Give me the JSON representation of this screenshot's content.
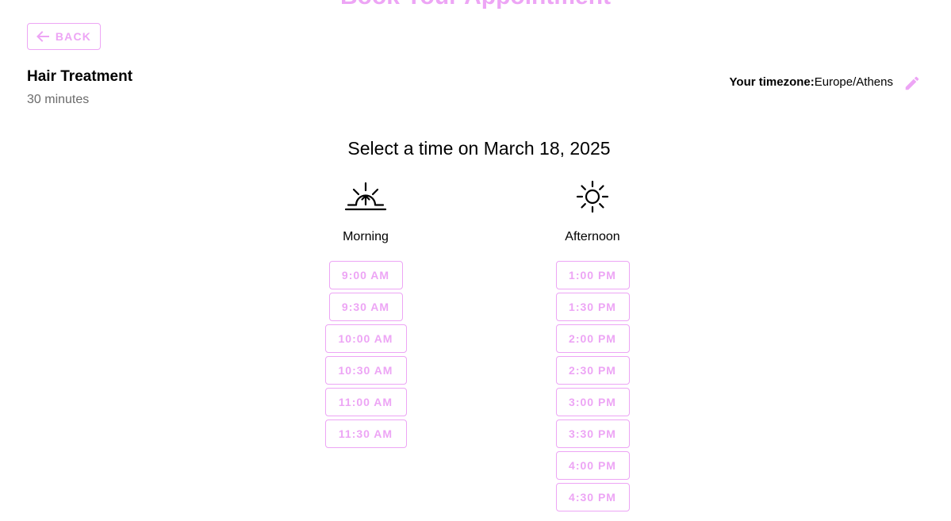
{
  "header": {
    "title": "Book Your Appointment",
    "back_label": "BACK"
  },
  "service": {
    "name": "Hair Treatment",
    "duration": "30 minutes"
  },
  "timezone": {
    "label": "Your timezone:",
    "value": "Europe/Athens"
  },
  "selection": {
    "heading": "Select a time on March 18, 2025"
  },
  "morning": {
    "label": "Morning",
    "icon": "sunrise-icon",
    "slots": [
      "9:00 AM",
      "9:30 AM",
      "10:00 AM",
      "10:30 AM",
      "11:00 AM",
      "11:30 AM"
    ]
  },
  "afternoon": {
    "label": "Afternoon",
    "icon": "sun-icon",
    "slots": [
      "1:00 PM",
      "1:30 PM",
      "2:00 PM",
      "2:30 PM",
      "3:00 PM",
      "3:30 PM",
      "4:00 PM",
      "4:30 PM"
    ]
  },
  "colors": {
    "accent": "#eda5f5",
    "muted_text": "#6b6b6b"
  }
}
